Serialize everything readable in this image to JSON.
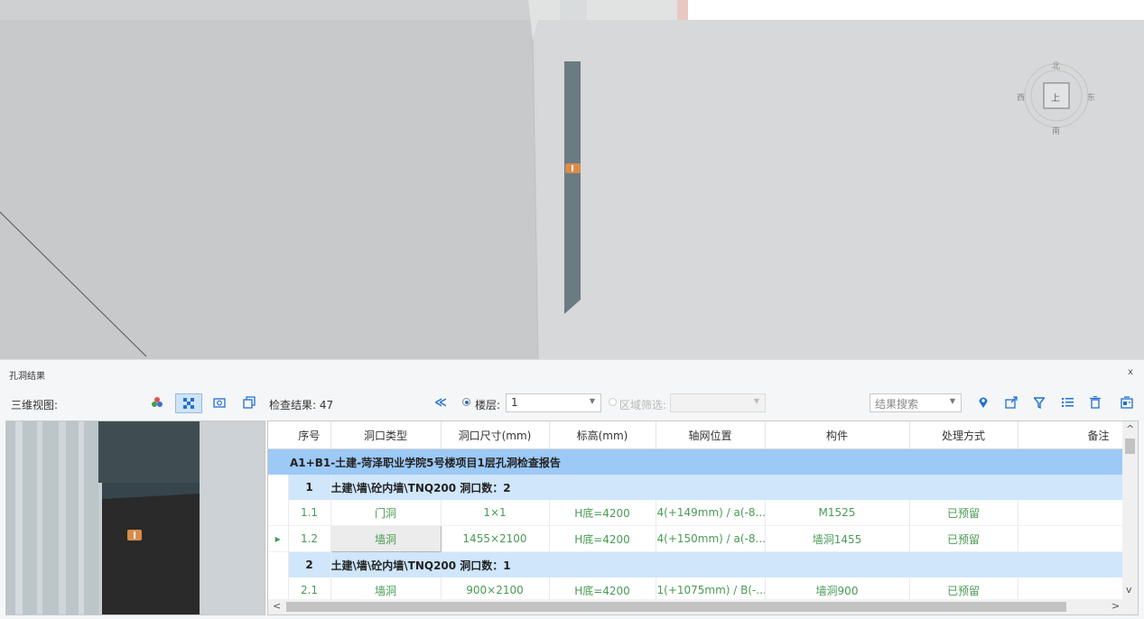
{
  "viewport": {
    "compass": {
      "north": "北",
      "south": "南",
      "east": "东",
      "west": "西",
      "center": "上"
    }
  },
  "panel": {
    "title": "孔洞结果",
    "close": "x",
    "toolbar": {
      "view_label": "三维视图:",
      "result_count": "检查结果: 47",
      "floor_label": "楼层:",
      "floor_value": "1",
      "area_label": "区域筛选:",
      "area_value": "",
      "search_placeholder": "结果搜索",
      "icons": [
        "color-icon",
        "scatter-icon",
        "camera-icon",
        "box-view-icon",
        "collapse-icon",
        "locate-icon",
        "export-icon",
        "filter-icon",
        "list-icon",
        "clear-icon",
        "report-icon"
      ]
    },
    "table": {
      "headers": [
        "序号",
        "洞口类型",
        "洞口尺寸(mm)",
        "标高(mm)",
        "轴网位置",
        "构件",
        "处理方式",
        "备注"
      ],
      "group_title": "A1+B1-土建-菏泽职业学院5号楼项目1层孔洞检查报告",
      "groups": [
        {
          "index": "1",
          "title": "土建\\墙\\砼内墙\\TNQ200  洞口数：2",
          "rows": [
            {
              "no": "1.1",
              "type": "门洞",
              "size": "1×1",
              "elevation": "H底=4200",
              "axis": "4(+149mm) / a(-8...",
              "component": "M1525",
              "method": "已预留",
              "note": ""
            },
            {
              "no": "1.2",
              "type": "墙洞",
              "size": "1455×2100",
              "elevation": "H底=4200",
              "axis": "4(+150mm) / a(-8...",
              "component": "墙洞1455",
              "method": "已预留",
              "note": ""
            }
          ]
        },
        {
          "index": "2",
          "title": "土建\\墙\\砼内墙\\TNQ200  洞口数：1",
          "rows": [
            {
              "no": "2.1",
              "type": "墙洞",
              "size": "900×2100",
              "elevation": "H底=4200",
              "axis": "1(+1075mm) / B(-...",
              "component": "墙洞900",
              "method": "已预留",
              "note": ""
            }
          ]
        }
      ]
    }
  },
  "colors": {
    "accent": "#1f6fd1",
    "group_row": "#9cc9f6",
    "sub_row": "#cfe6fb",
    "data_text": "#4a9a55",
    "marker": "#d98c4a"
  }
}
